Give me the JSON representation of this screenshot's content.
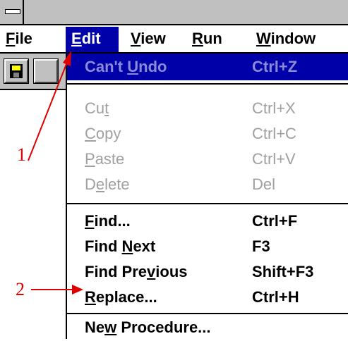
{
  "menubar": {
    "items": [
      {
        "pre": "",
        "u": "F",
        "post": "ile"
      },
      {
        "pre": "",
        "u": "E",
        "post": "dit"
      },
      {
        "pre": "",
        "u": "V",
        "post": "iew"
      },
      {
        "pre": "",
        "u": "R",
        "post": "un"
      },
      {
        "pre": "",
        "u": "W",
        "post": "indow"
      }
    ]
  },
  "edit_menu": {
    "undo": {
      "pre": "Can't ",
      "u": "U",
      "post": "ndo",
      "shortcut": "Ctrl+Z"
    },
    "cut": {
      "pre": "Cu",
      "u": "t",
      "post": "",
      "shortcut": "Ctrl+X"
    },
    "copy": {
      "pre": "",
      "u": "C",
      "post": "opy",
      "shortcut": "Ctrl+C"
    },
    "paste": {
      "pre": "",
      "u": "P",
      "post": "aste",
      "shortcut": "Ctrl+V"
    },
    "delete": {
      "pre": "D",
      "u": "e",
      "post": "lete",
      "shortcut": "Del"
    },
    "find": {
      "pre": "",
      "u": "F",
      "post": "ind...",
      "shortcut": "Ctrl+F"
    },
    "find_next": {
      "pre": "Find ",
      "u": "N",
      "post": "ext",
      "shortcut": "F3"
    },
    "find_previous": {
      "pre": "Find Pre",
      "u": "v",
      "post": "ious",
      "shortcut": "Shift+F3"
    },
    "replace": {
      "pre": "",
      "u": "R",
      "post": "eplace...",
      "shortcut": "Ctrl+H"
    },
    "new_procedure": {
      "pre": "Ne",
      "u": "w",
      "post": " Procedure..."
    }
  },
  "annotations": {
    "label_1": "1",
    "label_2": "2",
    "color": "#e00000"
  },
  "colors": {
    "highlight": "#0000a8",
    "disabled_text": "#a0a0a0",
    "chrome": "#c0c0c0"
  }
}
